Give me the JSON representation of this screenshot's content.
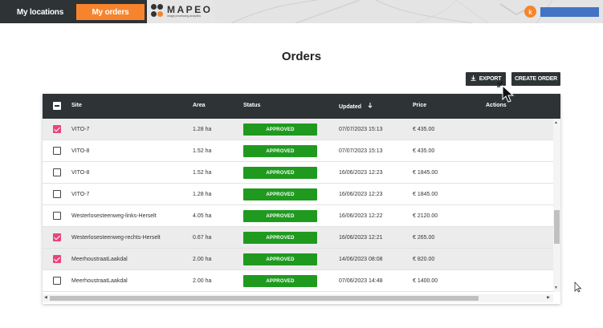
{
  "topbar": {
    "my_locations_label": "My locations",
    "my_orders_label": "My orders",
    "logo_text": "MAPEO",
    "logo_subtitle": "image processing analytics",
    "user_initial": "k",
    "accent_color": "#f7842c"
  },
  "page": {
    "title": "Orders"
  },
  "actions": {
    "export_label": "EXPORT",
    "create_order_label": "CREATE ORDER"
  },
  "table": {
    "headers": {
      "site": "Site",
      "area": "Area",
      "status": "Status",
      "updated": "Updated",
      "price": "Price",
      "actions": "Actions"
    },
    "rows": [
      {
        "selected": true,
        "site": "VITO-7",
        "area": "1.28 ha",
        "status": "APPROVED",
        "updated": "07/07/2023 15:13",
        "price": "€ 435.00"
      },
      {
        "selected": false,
        "site": "VITO-8",
        "area": "1.52 ha",
        "status": "APPROVED",
        "updated": "07/07/2023 15:13",
        "price": "€ 435.00"
      },
      {
        "selected": false,
        "site": "VITO-8",
        "area": "1.52 ha",
        "status": "APPROVED",
        "updated": "16/06/2023 12:23",
        "price": "€ 1845.00"
      },
      {
        "selected": false,
        "site": "VITO-7",
        "area": "1.28 ha",
        "status": "APPROVED",
        "updated": "16/06/2023 12:23",
        "price": "€ 1845.00"
      },
      {
        "selected": false,
        "site": "Westerlosesteenweg-links-Herselt",
        "area": "4.05 ha",
        "status": "APPROVED",
        "updated": "16/06/2023 12:22",
        "price": "€ 2120.00"
      },
      {
        "selected": true,
        "site": "Westerlosesteenweg-rechts-Herselt",
        "area": "0.67 ha",
        "status": "APPROVED",
        "updated": "16/06/2023 12:21",
        "price": "€ 265.00"
      },
      {
        "selected": true,
        "site": "MeerhoustraatLaakdal",
        "area": "2.00 ha",
        "status": "APPROVED",
        "updated": "14/06/2023 08:08",
        "price": "€ 820.00"
      },
      {
        "selected": false,
        "site": "MeerhoustraatLaakdal",
        "area": "2.00 ha",
        "status": "APPROVED",
        "updated": "07/06/2023 14:48",
        "price": "€ 1400.00"
      }
    ]
  },
  "colors": {
    "header_dark": "#2e3335",
    "approved_green": "#1f9a1f",
    "checkbox_pink": "#e8457a"
  }
}
